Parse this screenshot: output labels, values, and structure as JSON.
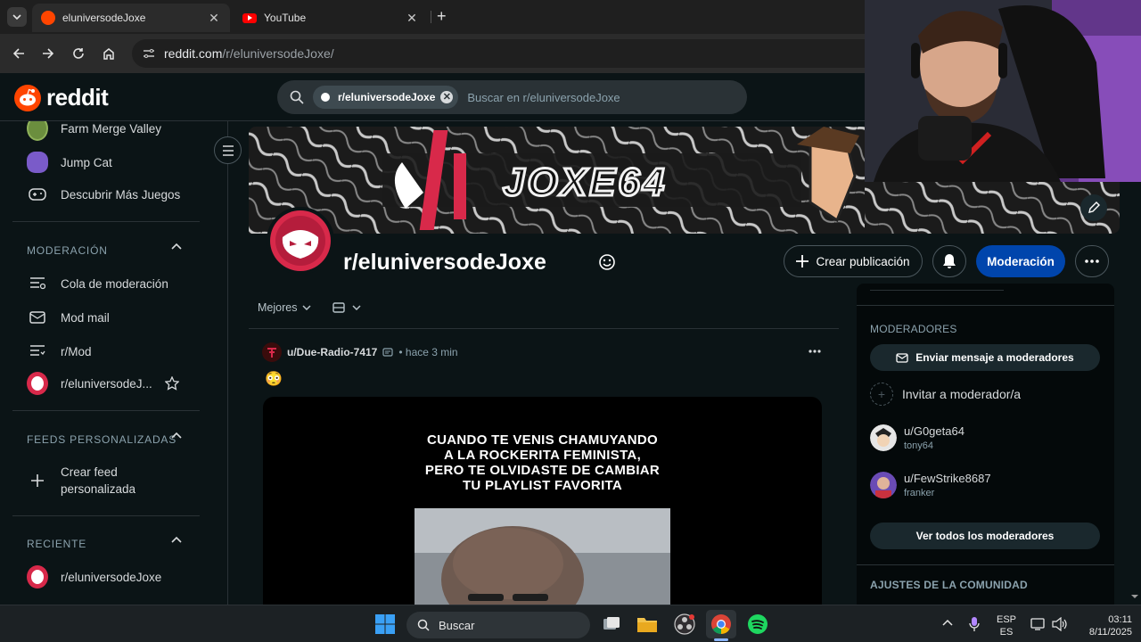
{
  "browser": {
    "tabs": [
      {
        "title": "eluniversodeJoxe",
        "active": true
      },
      {
        "title": "YouTube",
        "active": false
      }
    ],
    "url_host": "reddit.com",
    "url_path": "/r/eluniversodeJoxe/"
  },
  "header": {
    "wordmark": "reddit",
    "search_chip": "r/eluniversodeJoxe",
    "search_placeholder": "Buscar en r/eluniversodeJoxe"
  },
  "sidebar": {
    "games": [
      {
        "label": "Farm Merge Valley"
      },
      {
        "label": "Jump Cat"
      },
      {
        "label": "Descubrir Más Juegos"
      }
    ],
    "moderation": {
      "heading": "MODERACIÓN",
      "items": [
        {
          "label": "Cola de moderación"
        },
        {
          "label": "Mod mail"
        },
        {
          "label": "r/Mod"
        },
        {
          "label": "r/eluniversodeJ..."
        }
      ]
    },
    "feeds": {
      "heading": "FEEDS PERSONALIZADAS",
      "create_label": "Crear feed personalizada"
    },
    "recent": {
      "heading": "RECIENTE",
      "items": [
        {
          "label": "r/eluniversodeJoxe"
        }
      ]
    }
  },
  "community": {
    "banner_text": "JOXE64",
    "name": "r/eluniversodeJoxe",
    "create_post": "Crear publicación",
    "moderation_btn": "Moderación"
  },
  "feed": {
    "sort": "Mejores",
    "post": {
      "user": "u/Due-Radio-7417",
      "time": "• hace 3 min",
      "emoji": "😳",
      "meme_lines": [
        "CUANDO TE VENIS CHAMUYANDO",
        "A LA ROCKERITA FEMINISTA,",
        "PERO TE OLVIDASTE DE CAMBIAR",
        "TU PLAYLIST FAVORITA"
      ]
    }
  },
  "right_panel": {
    "moderators_heading": "MODERADORES",
    "message_mods": "Enviar mensaje a moderadores",
    "invite_mod": "Invitar a moderador/a",
    "mods": [
      {
        "name": "u/G0geta64",
        "flair": "tony64"
      },
      {
        "name": "u/FewStrike8687",
        "flair": "franker"
      }
    ],
    "view_all": "Ver todos los moderadores",
    "settings_heading": "AJUSTES DE LA COMUNIDAD"
  },
  "taskbar": {
    "search_label": "Buscar",
    "lang_top": "ESP",
    "lang_bottom": "ES",
    "time": "03:11",
    "date": "8/11/2025"
  },
  "colors": {
    "background": "#0b1416",
    "accent_blue": "#0045ac",
    "reddit_orange": "#ff4500"
  }
}
